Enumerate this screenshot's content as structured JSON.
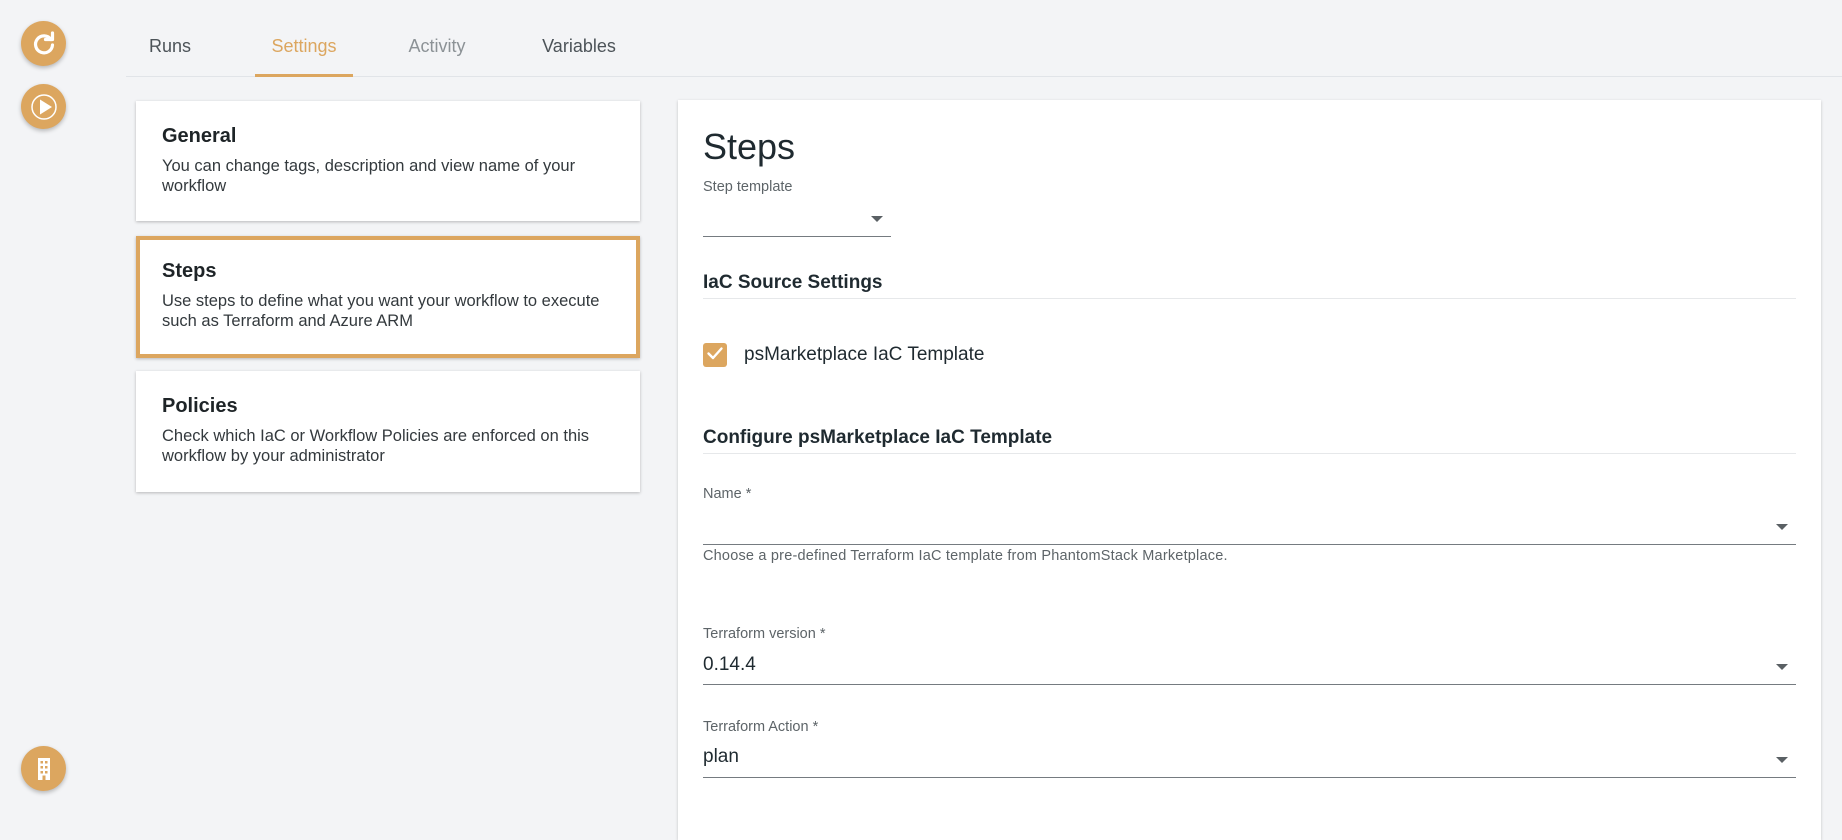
{
  "rail": {
    "top_icons": [
      "refresh-icon",
      "play-icon"
    ],
    "bottom_icon": "building-icon"
  },
  "tabs": [
    {
      "label": "Runs",
      "state": "normal"
    },
    {
      "label": "Settings",
      "state": "active"
    },
    {
      "label": "Activity",
      "state": "inactive"
    },
    {
      "label": "Variables",
      "state": "normal"
    }
  ],
  "cards": [
    {
      "title": "General",
      "desc": "You can change tags, description and view name of your workflow"
    },
    {
      "title": "Steps",
      "desc": "Use steps to define what you want your workflow to execute such as Terraform and Azure ARM",
      "selected": true
    },
    {
      "title": "Policies",
      "desc": "Check which IaC or Workflow Policies are enforced on this workflow by your administrator"
    }
  ],
  "panel": {
    "title": "Steps",
    "step_template_label": "Step template",
    "step_template_value": "",
    "iac_source_heading": "IaC Source Settings",
    "checkbox_label": "psMarketplace IaC Template",
    "checkbox_checked": true,
    "configure_heading": "Configure psMarketplace IaC Template",
    "name_label": "Name *",
    "name_value": "",
    "name_helper": "Choose a pre-defined Terraform IaC template from PhantomStack Marketplace.",
    "tf_version_label": "Terraform version *",
    "tf_version_value": "0.14.4",
    "tf_action_label": "Terraform Action *",
    "tf_action_value": "plan"
  },
  "colors": {
    "accent": "#dca65f",
    "background": "#f3f4f6",
    "panel": "#ffffff"
  }
}
